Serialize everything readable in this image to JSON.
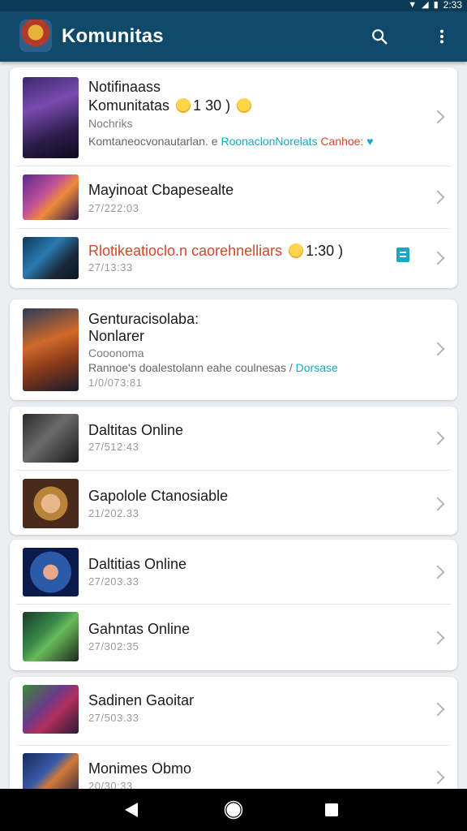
{
  "status": {
    "time": "2:33"
  },
  "appbar": {
    "title": "Komunitas"
  },
  "card1": {
    "row1": {
      "title": "Notifinaass",
      "line2": "Komunitatas",
      "count": "1 30 )",
      "sub": "Nochriks",
      "desc": "Komtaneocvonautarlan. e",
      "link_blue": "RoonaclonNorelats",
      "link_red": "Canhoe:"
    },
    "row2": {
      "title": "Mayinoat Cbapesealte",
      "date": "27/222:03"
    },
    "row3": {
      "title": "Rlotikeatioclo.n caorehnelliars",
      "count": "1:30 )",
      "date": "27/13:33"
    }
  },
  "card2": {
    "title": "Genturacisolaba:",
    "line2": "Nonlarer",
    "sub": "Cooonoma",
    "desc": "Rannoe's doalestolann eahe coulnesas /",
    "link": "Dorsase",
    "date": "1/0/073:81"
  },
  "card3": {
    "row1": {
      "title": "Daltitas Online",
      "date": "27/512:43"
    },
    "row2": {
      "title": "Gapolole Ctanosiable",
      "date": "21/202.33"
    }
  },
  "card4": {
    "row1": {
      "title": "Daltitias Online",
      "date": "27/203.33"
    },
    "row2": {
      "title": "Gahntas Online",
      "date": "27/302:35"
    }
  },
  "card5": {
    "row1": {
      "title": "Sadinen Gaoitar",
      "date": "27/503.33"
    },
    "row2": {
      "title": "Monimes Obmo",
      "date": "20/30:33"
    }
  },
  "colors": {
    "appbar": "#0f4a6b",
    "status": "#0d3a55",
    "accent_blue": "#1aa6c4",
    "accent_red": "#d5452c"
  },
  "icons": [
    "search-icon",
    "more-vert-icon",
    "chevron-right-icon",
    "back-icon",
    "home-icon",
    "recents-icon",
    "wifi-icon",
    "signal-icon",
    "battery-icon"
  ]
}
